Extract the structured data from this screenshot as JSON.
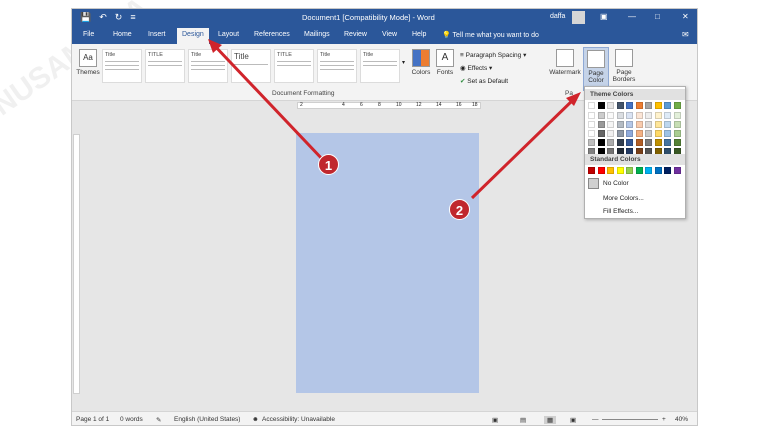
{
  "titlebar": {
    "title": "Document1 [Compatibility Mode] - Word",
    "user": "daffa",
    "qa_icons": [
      "save-icon",
      "undo-icon",
      "redo-icon",
      "customize-icon"
    ]
  },
  "tabs": [
    "File",
    "Home",
    "Insert",
    "Design",
    "Layout",
    "References",
    "Mailings",
    "Review",
    "View",
    "Help"
  ],
  "tell_me": "Tell me what you want to do",
  "ribbon": {
    "themes": "Themes",
    "style_titles": [
      "Title",
      "TITLE",
      "Title",
      "Title",
      "TITLE",
      "Title",
      "Title"
    ],
    "document_formatting": "Document Formatting",
    "colors": "Colors",
    "fonts": "Fonts",
    "paragraph_spacing": "Paragraph Spacing",
    "effects": "Effects",
    "set_as_default": "Set as Default",
    "watermark": "Watermark",
    "page_color_1": "Page",
    "page_color_2": "Color",
    "page_borders_1": "Page",
    "page_borders_2": "Borders",
    "page_bg_label": "Pa"
  },
  "dropdown": {
    "theme_colors": "Theme Colors",
    "standard_colors": "Standard Colors",
    "no_color": "No Color",
    "more_colors": "More Colors...",
    "fill_effects": "Fill Effects...",
    "theme_row": [
      "#ffffff",
      "#000000",
      "#e7e6e6",
      "#44546a",
      "#4472c4",
      "#ed7d31",
      "#a5a5a5",
      "#ffc000",
      "#5b9bd5",
      "#70ad47"
    ],
    "standard_row": [
      "#c00000",
      "#ff0000",
      "#ffc000",
      "#ffff00",
      "#92d050",
      "#00b050",
      "#00b0f0",
      "#0070c0",
      "#002060",
      "#7030a0"
    ]
  },
  "ruler_numbers": [
    "2",
    "2",
    "4",
    "6",
    "8",
    "10",
    "12",
    "14",
    "16",
    "18"
  ],
  "status": {
    "page": "Page 1 of 1",
    "words": "0 words",
    "language": "English (United States)",
    "accessibility": "Accessibility: Unavailable",
    "zoom": "40%"
  },
  "callouts": [
    "1",
    "2"
  ],
  "watermark_text": "NUSAMEDIA",
  "page_color": "#b4c6e7",
  "accent": "#2b579a",
  "arrow_color": "#d0242b"
}
